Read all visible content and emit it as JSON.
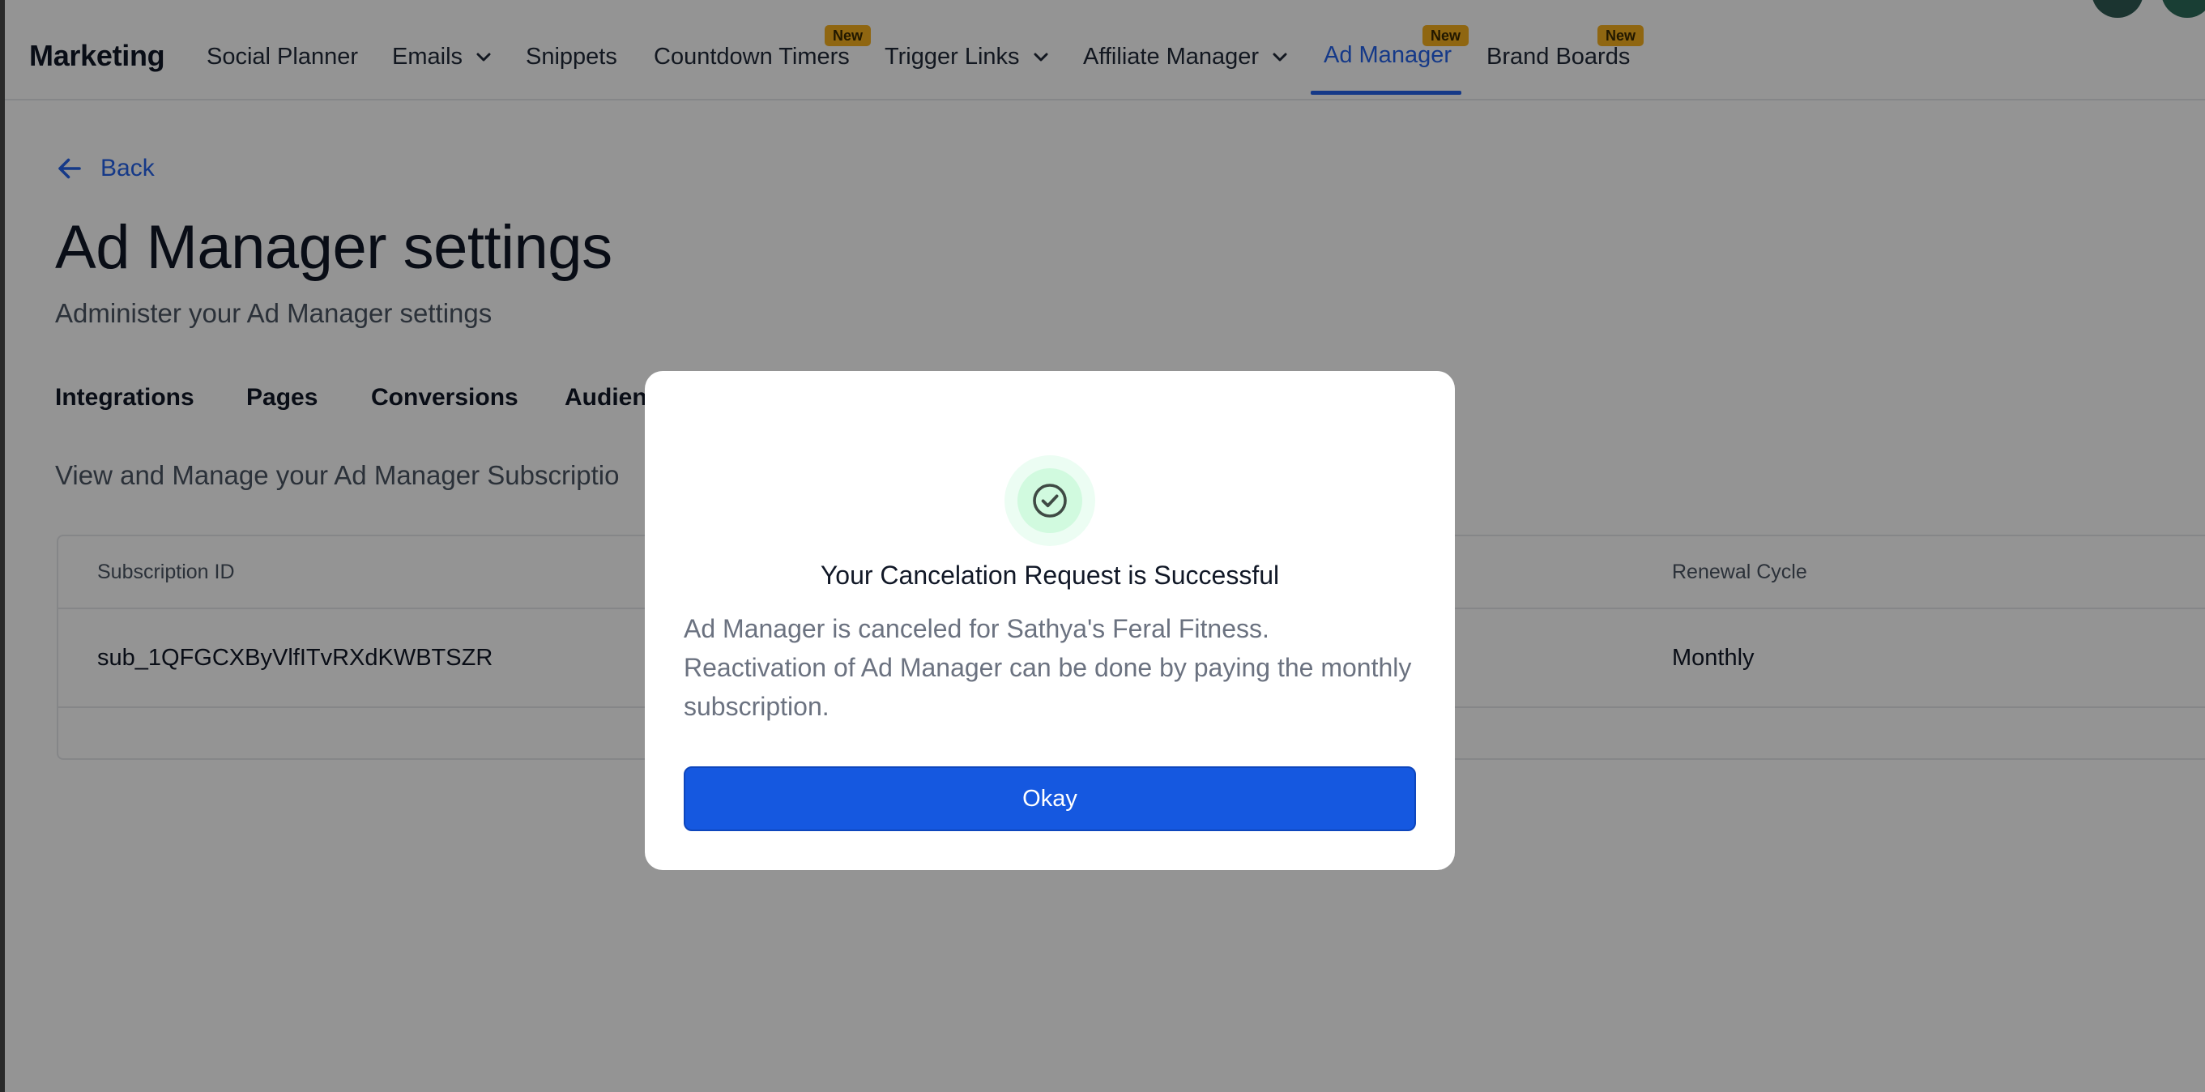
{
  "nav": {
    "brand": "Marketing",
    "items": [
      {
        "label": "Social Planner"
      },
      {
        "label": "Emails"
      },
      {
        "label": "Snippets"
      },
      {
        "label": "Countdown Timers",
        "badge": "New"
      },
      {
        "label": "Trigger Links"
      },
      {
        "label": "Affiliate Manager"
      },
      {
        "label": "Ad Manager",
        "badge": "New"
      },
      {
        "label": "Brand Boards",
        "badge": "New"
      }
    ],
    "active_color": "#2563eb",
    "badge_color": "#f6b01e"
  },
  "page": {
    "back_label": "Back",
    "title": "Ad Manager settings",
    "subtitle": "Administer your Ad Manager settings",
    "tabs": [
      "Integrations",
      "Pages",
      "Conversions",
      "Audienc"
    ],
    "section_desc": "View and Manage your Ad Manager Subscriptio"
  },
  "table": {
    "headers": {
      "subscription_id": "Subscription ID",
      "renewal_cycle": "Renewal Cycle"
    },
    "rows": [
      {
        "subscription_id": "sub_1QFGCXByVlfITvRXdKWBTSZR",
        "renewal_cycle": "Monthly"
      }
    ]
  },
  "modal": {
    "icon": "check-circle-icon",
    "title": "Your Cancelation Request is Successful",
    "body": "Ad Manager is canceled for Sathya's Feral Fitness. Reactivation of Ad Manager can be done by paying the monthly subscription.",
    "button_label": "Okay",
    "button_color": "#1558e0",
    "success_color": "#d1fadf"
  }
}
